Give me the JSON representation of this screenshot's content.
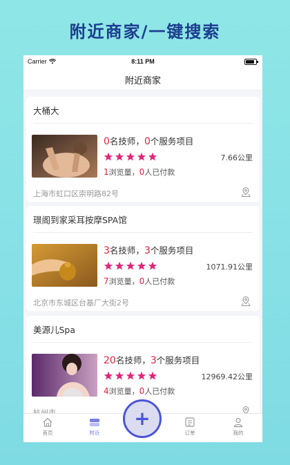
{
  "promo": {
    "title": "附近商家/一键搜索"
  },
  "status_bar": {
    "carrier": "Carrier",
    "time": "8:11 PM"
  },
  "nav": {
    "title": "附近商家"
  },
  "shops": [
    {
      "name": "大桶大",
      "technicians": "0",
      "technicians_label": "名技师，",
      "services": "0",
      "services_label": "个服务项目",
      "rating": 5,
      "distance": "7.66公里",
      "views": "1",
      "views_label": "浏览量，",
      "paid": "0",
      "paid_label": "人已付款",
      "address": "上海市虹口区崇明路82号"
    },
    {
      "name": "璟阁到家采耳按摩SPA馆",
      "technicians": "3",
      "technicians_label": "名技师，",
      "services": "3",
      "services_label": "个服务项目",
      "rating": 5,
      "distance": "1071.91公里",
      "views": "7",
      "views_label": "浏览量，",
      "paid": "0",
      "paid_label": "人已付款",
      "address": "北京市东城区台基厂大街2号"
    },
    {
      "name": "美源儿Spa",
      "technicians": "20",
      "technicians_label": "名技师，",
      "services": "3",
      "services_label": "个服务项目",
      "rating": 5,
      "distance": "12969.42公里",
      "views": "4",
      "views_label": "浏览量，",
      "paid": "0",
      "paid_label": "人已付款",
      "address": "杭州市"
    }
  ],
  "tabbar": {
    "home": "首页",
    "nearby": "附近",
    "add": "+",
    "orders": "订单",
    "mine": "我的"
  },
  "colors": {
    "accent": "#e81e3c",
    "star": "#e0277a",
    "tab_active": "#7a7fe0",
    "fab_border": "#4a55d8"
  }
}
